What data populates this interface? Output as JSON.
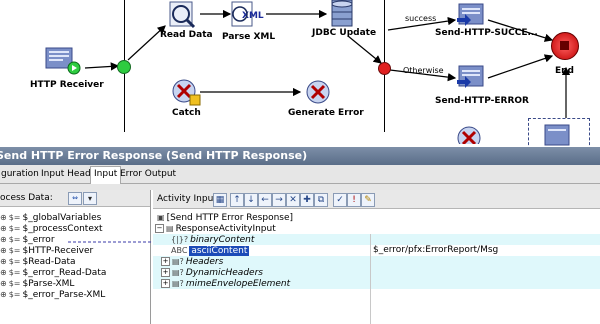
{
  "canvas": {
    "nodes": {
      "http_receiver": "HTTP Receiver",
      "read_data": "Read Data",
      "parse_xml": "Parse XML",
      "jdbc_update": "JDBC Update",
      "send_success": "Send-HTTP-SUCCE...",
      "end": "End",
      "catch": "Catch",
      "generate_error": "Generate Error",
      "send_error": "Send-HTTP-ERROR"
    },
    "transitions": {
      "success": "success",
      "otherwise": "Otherwise"
    },
    "icon_text": {
      "parse_xml_badge": "XML"
    }
  },
  "panel": {
    "title": "Send HTTP Error Response (Send HTTP Response)",
    "tabs": [
      "guration",
      "Input Headers",
      "Input",
      "Error Output"
    ],
    "active_tab": "Input"
  },
  "process_data": {
    "label": "ocess Data:",
    "items": [
      "$_globalVariables",
      "$_processContext",
      "$_error",
      "$HTTP-Receiver",
      "$Read-Data",
      "$_error_Read-Data",
      "$Parse-XML",
      "$_error_Parse-XML"
    ]
  },
  "activity_input": {
    "label": "Activity Input:",
    "rows": [
      {
        "text": "[Send HTTP Error Response]",
        "value": ""
      },
      {
        "text": "ResponseActivityInput",
        "value": ""
      },
      {
        "text": "binaryContent",
        "value": ""
      },
      {
        "text": "asciiContent",
        "value": "$_error/pfx:ErrorReport/Msg"
      },
      {
        "text": "Headers",
        "value": ""
      },
      {
        "text": "DynamicHeaders",
        "value": ""
      },
      {
        "text": "mimeEnvelopeElement",
        "value": ""
      }
    ]
  },
  "colors": {
    "accent": "#1c4bb8",
    "title_bar": "#6a7d98",
    "highlight": "#dff8fb",
    "start_node": "#2ecc40",
    "end_node": "#e02020"
  }
}
